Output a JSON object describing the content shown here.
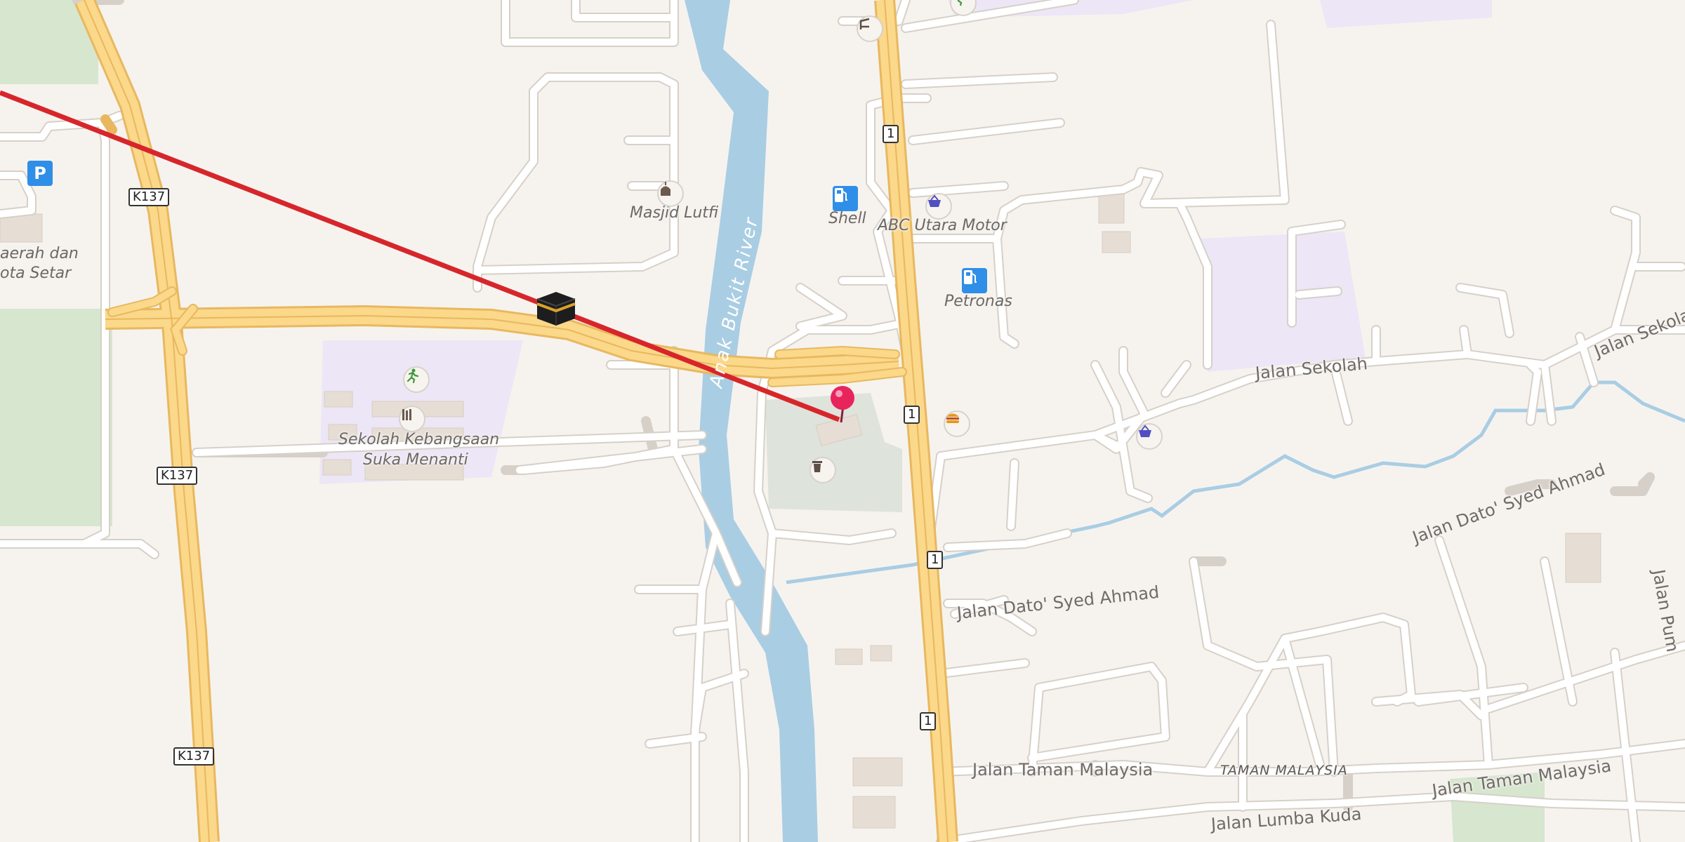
{
  "map": {
    "route_color": "#d7262b",
    "pin_color": "#e8245c",
    "water_color": "#a9cde3",
    "major_road_color": "#fbd88a",
    "road_casing_color": "#e8b85f",
    "minor_road_color": "#ffffff",
    "school_area_color": "#ece6f6",
    "park_color": "#d7e6cf"
  },
  "labels": {
    "masjid": "Masjid Lutfi",
    "shell": "Shell",
    "abc_motor": "ABC Utara Motor",
    "petronas": "Petronas",
    "school_line1": "Sekolah Kebangsaan",
    "school_line2": "Suka Menanti",
    "partial_left_1": "aerah dan",
    "partial_left_2": "ota Setar",
    "river": "Anak Bukit River",
    "taman_malaysia": "TAMAN MALAYSIA"
  },
  "streets": {
    "jalan_sekolah_1": "Jalan Sekolah",
    "jalan_sekolah_2": "Jalan Sekola",
    "dato_syed_1": "Jalan Dato' Syed Ahmad",
    "dato_syed_2": "Jalan Dato' Syed Ahmad",
    "taman_malaysia_1": "Jalan Taman Malaysia",
    "taman_malaysia_2": "Jalan Taman Malaysia",
    "lumba_kuda": "Jalan Lumba Kuda",
    "right_edge": "Jalan Pum"
  },
  "shields": {
    "k137_a": "K137",
    "k137_b": "K137",
    "k137_c": "K137",
    "r1_a": "1",
    "r1_b": "1",
    "r1_c": "1",
    "r1_d": "1"
  },
  "icons": {
    "parking": "P",
    "fuel": "fuel-pump-icon",
    "shop": "shopping-basket-icon",
    "mosque": "mosque-icon",
    "sport": "running-icon",
    "library": "library-icon",
    "cafe": "burger-icon",
    "waste": "waste-basket-icon",
    "kaaba": "kaaba-icon",
    "pin": "location-pin-icon"
  }
}
